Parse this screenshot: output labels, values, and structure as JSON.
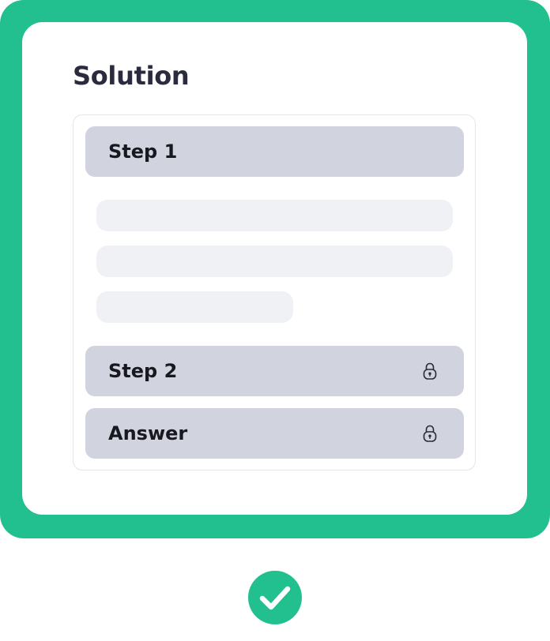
{
  "colors": {
    "frame": "#22c08e",
    "card": "#ffffff",
    "step_background": "#d1d3de",
    "skeleton": "#f0f1f5",
    "title_text": "#2b2b3f",
    "step_text": "#18181f",
    "check_circle": "#22c08e"
  },
  "solution": {
    "title": "Solution",
    "steps": [
      {
        "label": "Step 1",
        "locked": false,
        "expanded": true
      },
      {
        "label": "Step 2",
        "locked": true,
        "icon": "lock-icon"
      },
      {
        "label": "Answer",
        "locked": true,
        "icon": "lock-icon"
      }
    ]
  },
  "status": {
    "icon": "checkmark-circle-icon"
  }
}
